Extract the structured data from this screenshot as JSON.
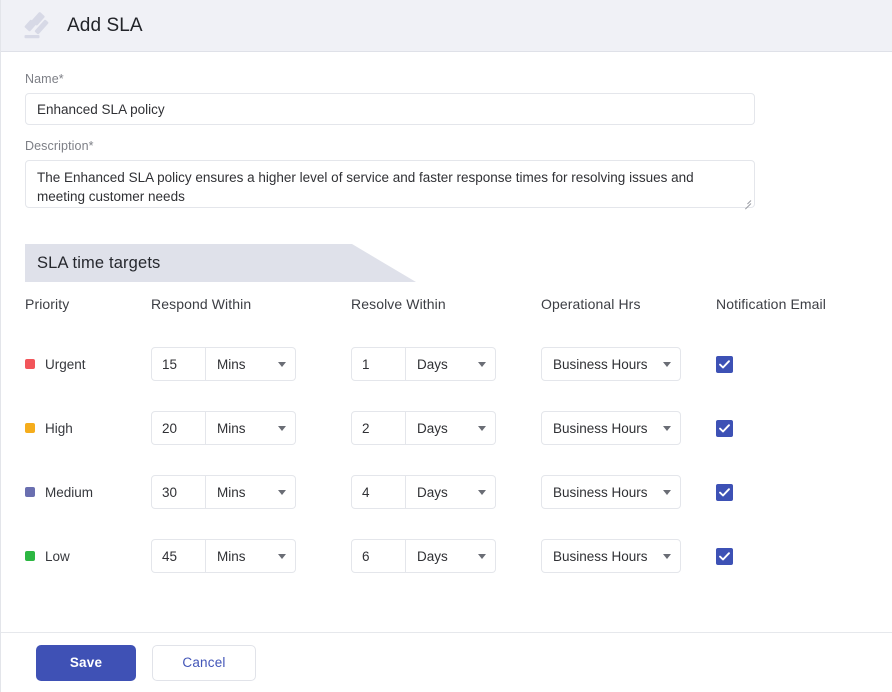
{
  "header": {
    "title": "Add SLA",
    "icon": "gavel-icon",
    "background": "#f0f1f6"
  },
  "form": {
    "name": {
      "label": "Name*",
      "value": "Enhanced SLA policy",
      "placeholder": "Name"
    },
    "description": {
      "label": "Description*",
      "value": "The Enhanced SLA policy ensures a higher level of service and faster response times for resolving issues and meeting customer needs",
      "placeholder": "Description"
    }
  },
  "section": {
    "banner_title": "SLA time targets",
    "banner_color": "#dfe1ea"
  },
  "table": {
    "headers": {
      "priority": "Priority",
      "respond": "Respond Within",
      "resolve": "Resolve Within",
      "operational": "Operational Hrs",
      "notification": "Notification Email"
    },
    "rows": [
      {
        "priority": "Urgent",
        "priority_color": "#f2555a",
        "respond_value": "15",
        "respond_unit": "Mins",
        "resolve_value": "1",
        "resolve_unit": "Days",
        "operational_hours": "Business Hours",
        "notification_checked": true
      },
      {
        "priority": "High",
        "priority_color": "#f5ad1d",
        "respond_value": "20",
        "respond_unit": "Mins",
        "resolve_value": "2",
        "resolve_unit": "Days",
        "operational_hours": "Business Hours",
        "notification_checked": true
      },
      {
        "priority": "Medium",
        "priority_color": "#6a6fb0",
        "respond_value": "30",
        "respond_unit": "Mins",
        "resolve_value": "4",
        "resolve_unit": "Days",
        "operational_hours": "Business Hours",
        "notification_checked": true
      },
      {
        "priority": "Low",
        "priority_color": "#2cb742",
        "respond_value": "45",
        "respond_unit": "Mins",
        "resolve_value": "6",
        "resolve_unit": "Days",
        "operational_hours": "Business Hours",
        "notification_checked": true
      }
    ]
  },
  "footer": {
    "save_label": "Save",
    "cancel_label": "Cancel",
    "save_color": "#3f51b5"
  }
}
